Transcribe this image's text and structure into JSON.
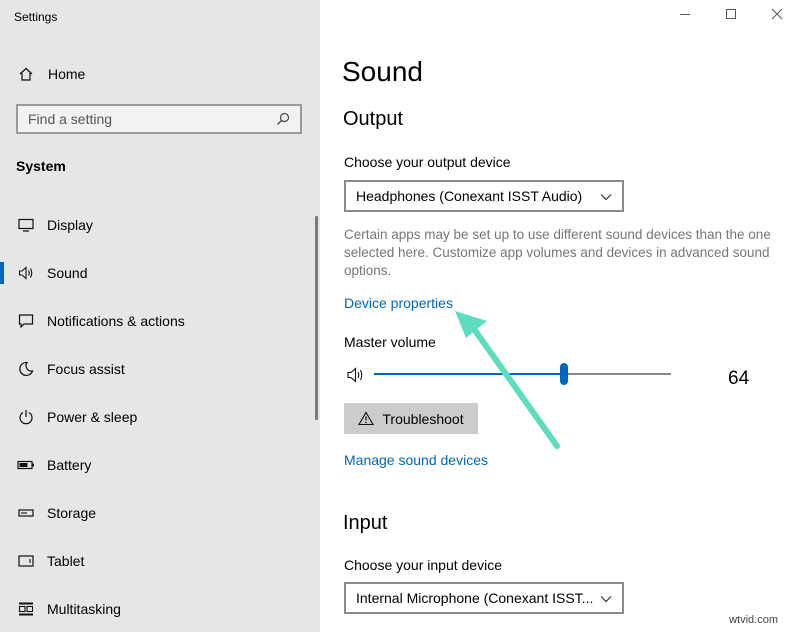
{
  "window": {
    "title": "Settings",
    "controls": [
      "minimize-icon",
      "maximize-icon",
      "close-icon"
    ]
  },
  "sidebar": {
    "home_label": "Home",
    "search_placeholder": "Find a setting",
    "section": "System",
    "items": [
      {
        "label": "Display",
        "icon": "display-icon"
      },
      {
        "label": "Sound",
        "icon": "speaker-icon",
        "selected": true
      },
      {
        "label": "Notifications & actions",
        "icon": "notification-icon"
      },
      {
        "label": "Focus assist",
        "icon": "moon-icon"
      },
      {
        "label": "Power & sleep",
        "icon": "power-icon"
      },
      {
        "label": "Battery",
        "icon": "battery-icon"
      },
      {
        "label": "Storage",
        "icon": "storage-icon"
      },
      {
        "label": "Tablet",
        "icon": "tablet-icon"
      },
      {
        "label": "Multitasking",
        "icon": "multitasking-icon"
      }
    ]
  },
  "main": {
    "title": "Sound",
    "output": {
      "heading": "Output",
      "device_label": "Choose your output device",
      "device_value": "Headphones (Conexant ISST Audio)",
      "description": "Certain apps may be set up to use different sound devices than the one selected here. Customize app volumes and devices in advanced sound options.",
      "device_properties_link": "Device properties",
      "master_volume_label": "Master volume",
      "volume": 64,
      "troubleshoot_label": "Troubleshoot",
      "manage_link": "Manage sound devices"
    },
    "input": {
      "heading": "Input",
      "device_label": "Choose your input device",
      "device_value": "Internal Microphone (Conexant ISST..."
    }
  },
  "annotation": {
    "arrow_color": "#5fdcc0"
  },
  "accent_color": "#0067c0",
  "watermark": "wtvid.com"
}
